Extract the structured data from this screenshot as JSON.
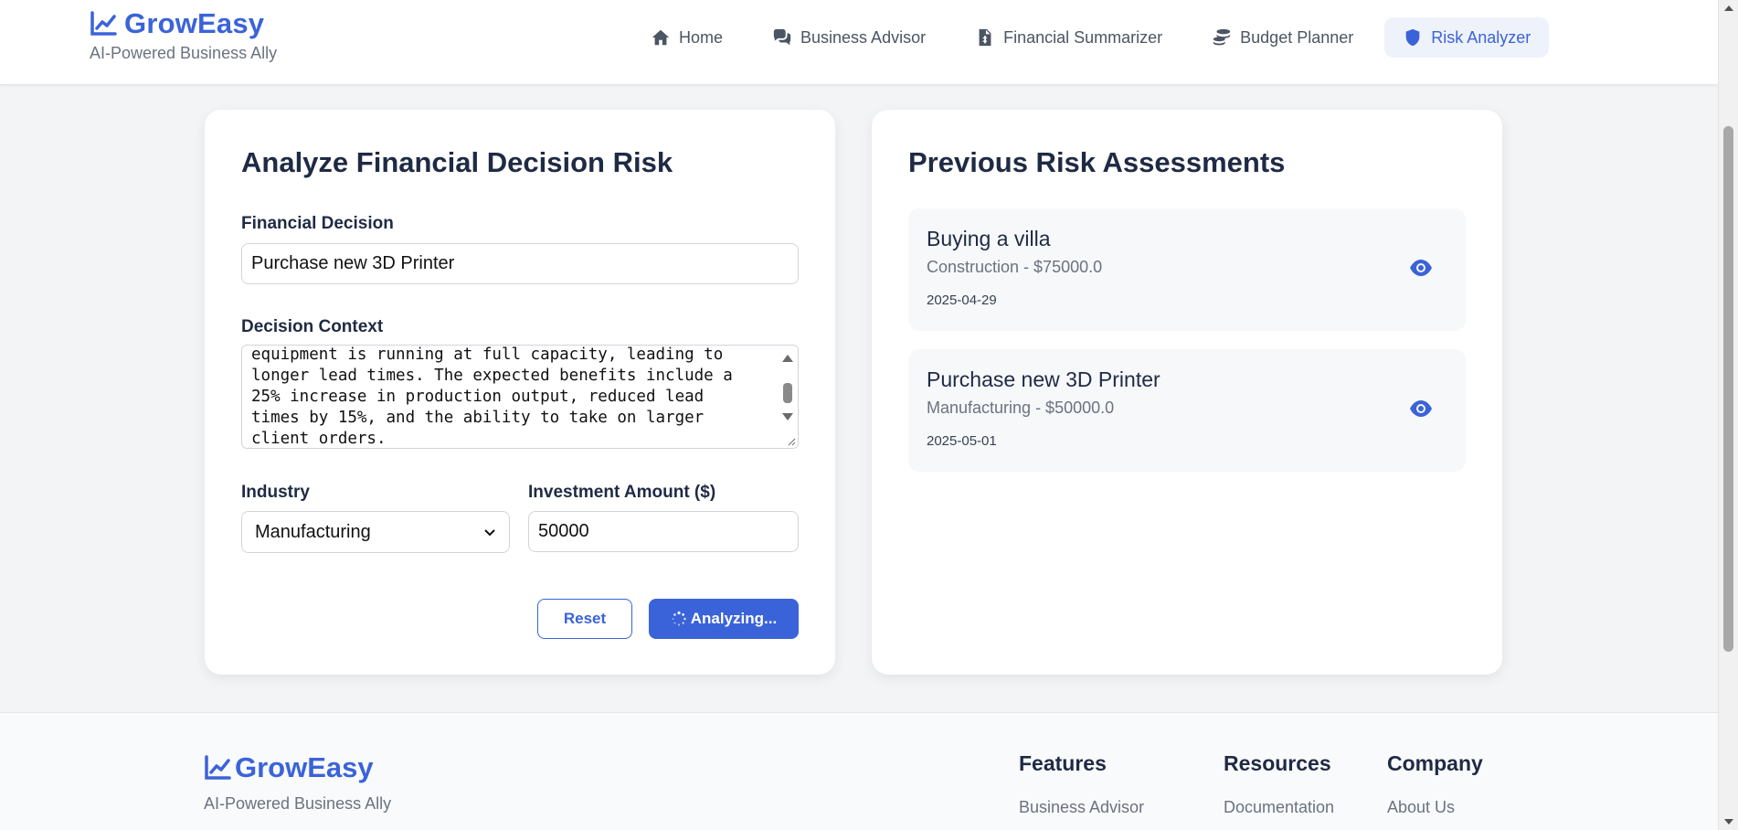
{
  "brand": {
    "name": "GrowEasy",
    "tagline": "AI-Powered Business Ally",
    "accent": "#3b63d9"
  },
  "nav": {
    "items": [
      {
        "label": "Home",
        "icon": "home-icon",
        "active": false
      },
      {
        "label": "Business Advisor",
        "icon": "comments-icon",
        "active": false
      },
      {
        "label": "Financial Summarizer",
        "icon": "file-invoice-icon",
        "active": false
      },
      {
        "label": "Budget Planner",
        "icon": "coins-icon",
        "active": false
      },
      {
        "label": "Risk Analyzer",
        "icon": "shield-icon",
        "active": true
      }
    ]
  },
  "form": {
    "title": "Analyze Financial Decision Risk",
    "decision_label": "Financial Decision",
    "decision_value": "Purchase new 3D Printer",
    "context_label": "Decision Context",
    "context_value": "equipment is running at full capacity, leading to\nlonger lead times. The expected benefits include a\n25% increase in production output, reduced lead\ntimes by 15%, and the ability to take on larger\nclient orders.",
    "industry_label": "Industry",
    "industry_value": "Manufacturing",
    "amount_label": "Investment Amount ($)",
    "amount_value": "50000",
    "reset_label": "Reset",
    "analyze_label": "Analyzing..."
  },
  "history": {
    "title": "Previous Risk Assessments",
    "items": [
      {
        "title": "Buying a villa",
        "subtitle": "Construction - $75000.0",
        "date": "2025-04-29"
      },
      {
        "title": "Purchase new 3D Printer",
        "subtitle": "Manufacturing - $50000.0",
        "date": "2025-05-01"
      }
    ]
  },
  "footer": {
    "brand": "GrowEasy",
    "tagline": "AI-Powered Business Ally",
    "columns": [
      {
        "title": "Features",
        "first_link": "Business Advisor"
      },
      {
        "title": "Resources",
        "first_link": "Documentation"
      },
      {
        "title": "Company",
        "first_link": "About Us"
      }
    ]
  }
}
